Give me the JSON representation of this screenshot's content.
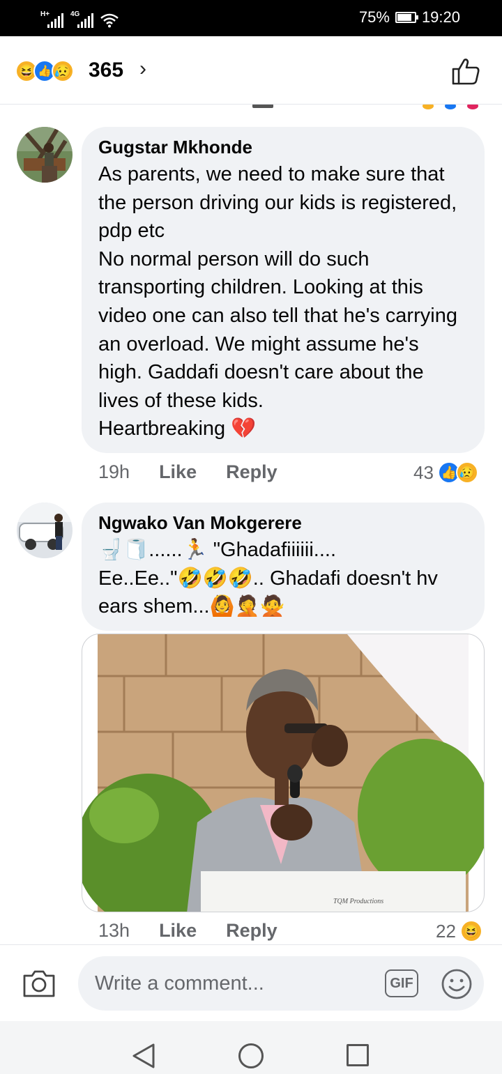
{
  "status_bar": {
    "network_1": "H+",
    "network_2": "4G",
    "battery": "75%",
    "time": "19:20",
    "icons": [
      "signal-icon",
      "signal-icon",
      "wifi-icon",
      "battery-icon"
    ]
  },
  "reactions_header": {
    "reaction_icons": [
      "haha",
      "like",
      "sad"
    ],
    "count": "365",
    "chevron": "›"
  },
  "comments": [
    {
      "author": "Gugstar Mkhonde",
      "text": "As parents, we need to make sure that the person driving our kids is registered, pdp etc\nNo normal person will do such transporting children. Looking at this video one can also tell that he's carrying an overload. We might assume he's high. Gaddafi doesn't care about the lives of these kids.\nHeartbreaking 💔",
      "time": "19h",
      "like_label": "Like",
      "reply_label": "Reply",
      "reaction_count": "43",
      "reaction_icons": [
        "like",
        "sad"
      ]
    },
    {
      "author": "Ngwako Van Mokgerere",
      "text": "🚽🧻......🏃 \"Ghadafiiiiii....\nEe..Ee..\"🤣🤣🤣.. Ghadafi doesn't hv ears shem...🙆🤦🙅",
      "watermark": "TQM Productions",
      "time": "13h",
      "like_label": "Like",
      "reply_label": "Reply",
      "reaction_count": "22",
      "reaction_icons": [
        "haha"
      ]
    }
  ],
  "comment_bar": {
    "placeholder": "Write a comment...",
    "gif_label": "GIF"
  },
  "colors": {
    "bubble": "#f0f2f5",
    "meta_text": "#65676b",
    "like_blue": "#1877f2",
    "reaction_yellow": "#f7b125"
  }
}
